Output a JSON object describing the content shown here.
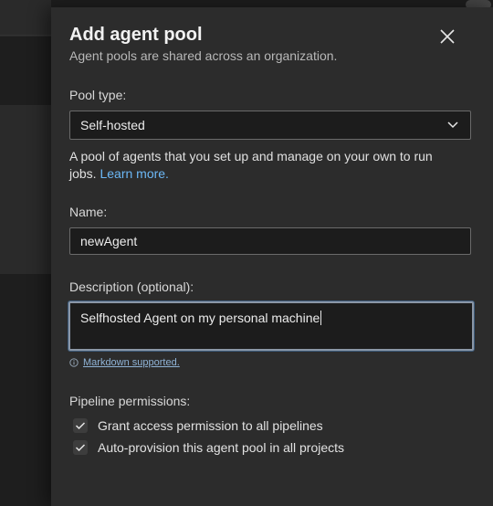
{
  "panel": {
    "title": "Add agent pool",
    "subtitle": "Agent pools are shared across an organization."
  },
  "pool_type": {
    "label": "Pool type:",
    "selected": "Self-hosted",
    "description": "A pool of agents that you set up and manage on your own to run jobs.",
    "learn_more": "Learn more."
  },
  "name": {
    "label": "Name:",
    "value": "newAgent"
  },
  "description": {
    "label": "Description (optional):",
    "value": "Selfhosted Agent on my personal machine",
    "markdown_hint": "Markdown supported."
  },
  "permissions": {
    "label": "Pipeline permissions:",
    "options": [
      {
        "label": "Grant access permission to all pipelines",
        "checked": true
      },
      {
        "label": "Auto-provision this agent pool in all projects",
        "checked": true
      }
    ]
  },
  "icons": {
    "close": "close-icon",
    "dropdown": "chevron-down-icon",
    "info": "info-icon",
    "check": "checkmark-icon"
  },
  "colors": {
    "panel_bg": "#2c2c2c",
    "link": "#6cb8f6",
    "focus_border": "#8a96a6"
  }
}
